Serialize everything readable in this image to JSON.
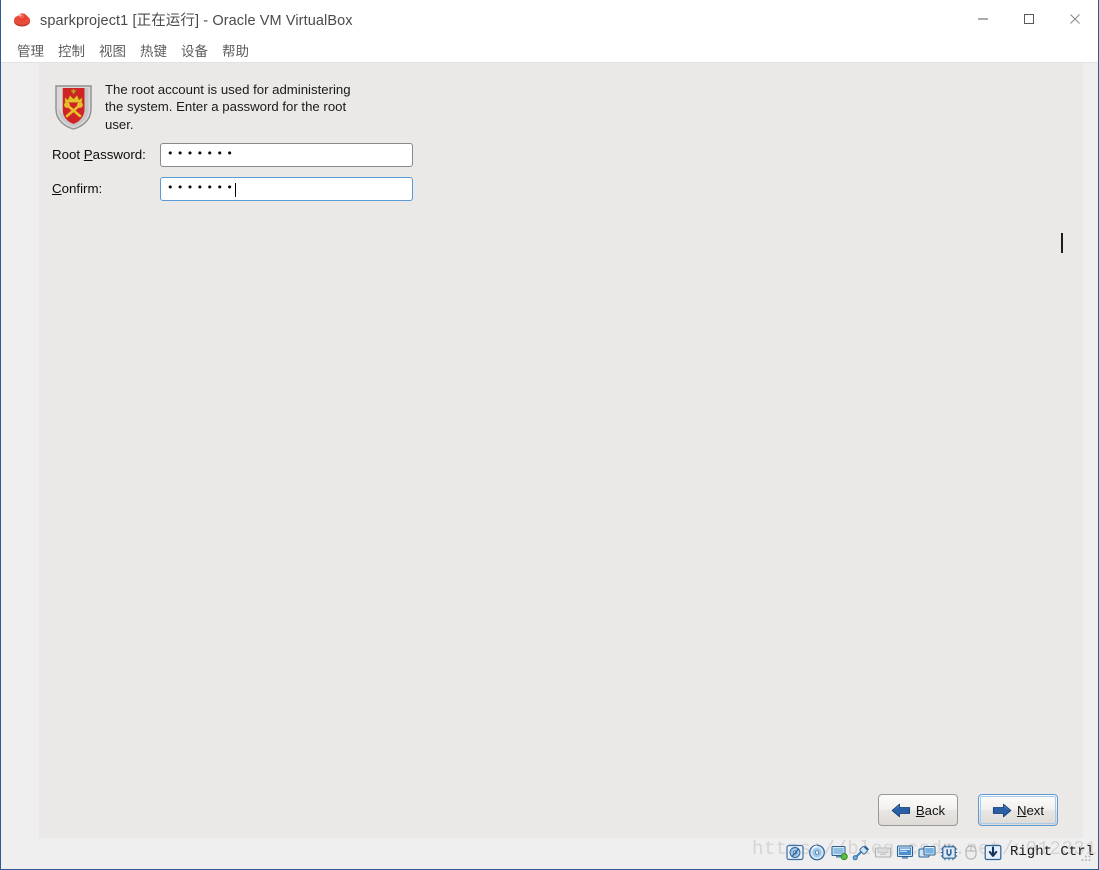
{
  "window": {
    "title": "sparkproject1 [正在运行] - Oracle VM VirtualBox",
    "logo_icon": "virtualbox-logo-icon",
    "controls": [
      {
        "name": "minimize-button",
        "icon": "minimize-icon"
      },
      {
        "name": "maximize-button",
        "icon": "maximize-icon"
      },
      {
        "name": "close-button",
        "icon": "close-icon"
      }
    ]
  },
  "menu": {
    "items": [
      {
        "label": "管理"
      },
      {
        "label": "控制"
      },
      {
        "label": "视图"
      },
      {
        "label": "热键"
      },
      {
        "label": "设备"
      },
      {
        "label": "帮助"
      }
    ]
  },
  "guest": {
    "dialog": {
      "icon": "root-password-shield-icon",
      "description": "The root account is used for administering\nthe system.  Enter a password for the root\nuser.",
      "fields": [
        {
          "name": "root-password",
          "label_before": "Root ",
          "label_mnemonic": "P",
          "label_after": "assword:",
          "value": "•••••••",
          "focused": false,
          "caret": false
        },
        {
          "name": "confirm-password",
          "label_before": "",
          "label_mnemonic": "C",
          "label_after": "onfirm:",
          "value": "•••••••",
          "focused": true,
          "caret": true
        }
      ]
    },
    "nav": {
      "back": {
        "before": "",
        "mnemonic": "B",
        "after": "ack",
        "icon": "arrow-left-icon",
        "focused": false
      },
      "next": {
        "before": "",
        "mnemonic": "N",
        "after": "ext",
        "icon": "arrow-right-icon",
        "focused": true
      }
    }
  },
  "status_bar": {
    "watermark": "https://blog.csdn.net/u0123318074",
    "host_key_label": "Right Ctrl",
    "icons": [
      {
        "name": "hard-disk-icon",
        "active": true
      },
      {
        "name": "optical-drive-icon",
        "active": true
      },
      {
        "name": "network-adapter-icon",
        "active": true
      },
      {
        "name": "usb-device-icon",
        "active": true
      },
      {
        "name": "floppy-drive-icon",
        "active": false
      },
      {
        "name": "display-icon",
        "active": true
      },
      {
        "name": "shared-folders-icon",
        "active": true
      },
      {
        "name": "cpu-features-icon",
        "active": true
      },
      {
        "name": "mouse-integration-icon",
        "active": false
      },
      {
        "name": "host-key-icon",
        "active": true
      }
    ],
    "resize_grip_icon": "resize-grip-icon"
  },
  "colors": {
    "window_border": "#2d5a91",
    "host_bg": "#efefef",
    "guest_bg": "#ebe9e7",
    "focus_blue": "#5b9bd5",
    "arrow_blue": "#2a5fa8",
    "shield_red": "#cf2326",
    "shield_gold": "#e8c02c"
  }
}
